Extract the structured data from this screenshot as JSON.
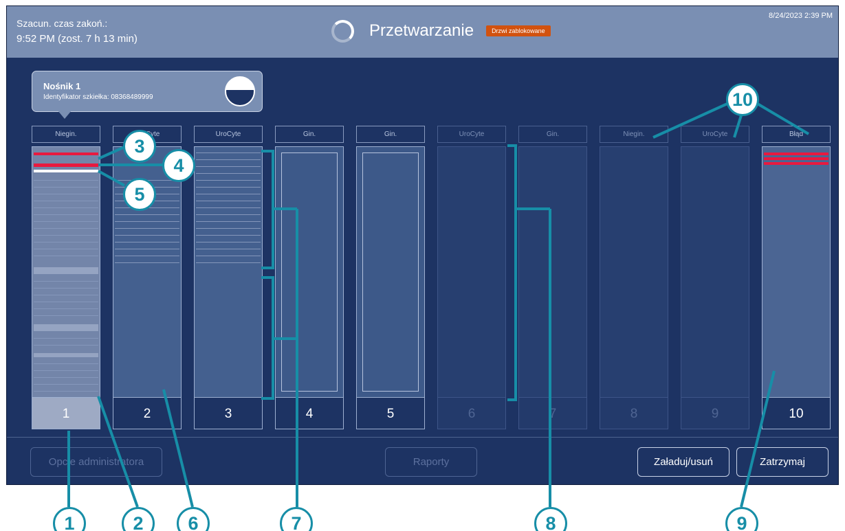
{
  "header": {
    "eta_label": "Szacun. czas zakoń.:",
    "eta_value": "9:52 PM (zost. 7 h 13 min)",
    "status": "Przetwarzanie",
    "door_badge": "Drzwi zablokowane",
    "datetime": "8/24/2023 2:39 PM"
  },
  "tooltip": {
    "title": "Nośnik 1",
    "subtitle": "Identyfikator szkiełka: 08368489999"
  },
  "slots": [
    {
      "label": "Niegin.",
      "number": "1"
    },
    {
      "label": "UroCyte",
      "number": "2"
    },
    {
      "label": "UroCyte",
      "number": "3"
    },
    {
      "label": "Gin.",
      "number": "4"
    },
    {
      "label": "Gin.",
      "number": "5"
    },
    {
      "label": "UroCyte",
      "number": "6"
    },
    {
      "label": "Gin.",
      "number": "7"
    },
    {
      "label": "Niegin.",
      "number": "8"
    },
    {
      "label": "UroCyte",
      "number": "9"
    },
    {
      "label": "Błąd",
      "number": "10"
    }
  ],
  "footer": {
    "admin": "Opcje administratora",
    "reports": "Raporty",
    "load": "Załaduj/usuń",
    "stop": "Zatrzymaj"
  },
  "callouts": {
    "c1": "1",
    "c2": "2",
    "c3": "3",
    "c4": "4",
    "c5": "5",
    "c6": "6",
    "c7": "7",
    "c8": "8",
    "c9": "9",
    "c10": "10"
  },
  "colors": {
    "screen_bg": "#1d3363",
    "header_bg": "#7a8fb3",
    "badge": "#d2520f",
    "error_line": "#e8193f",
    "callout": "#178ea7"
  }
}
